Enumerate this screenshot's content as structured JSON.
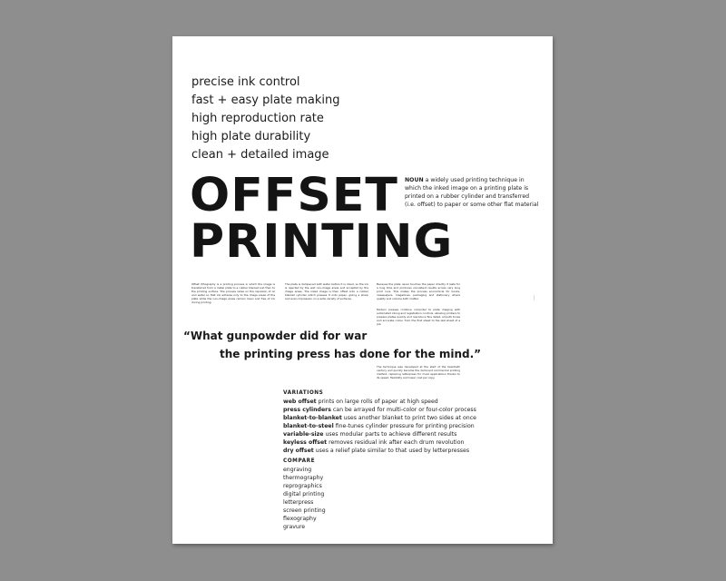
{
  "benefits": [
    "precise ink control",
    "fast + easy plate making",
    "high reproduction rate",
    "high plate durability",
    "clean + detailed image"
  ],
  "headline": {
    "line1": "OFFSET",
    "line2": "PRINTING"
  },
  "definition": {
    "part_of_speech": "NOUN",
    "text": "a widely used printing technique in which the inked image on a printing plate is printed on a rubber cylinder and transferred (i.e. offset) to paper or some other flat material"
  },
  "quote": {
    "line1": "“What gunpowder did for war",
    "line2": "the printing press has done for the mind.”"
  },
  "variations": {
    "title": "VARIATIONS",
    "items": [
      {
        "term": "web offset",
        "desc": " prints on large rolls of paper at high speed"
      },
      {
        "term": "press cylinders",
        "desc": " can be arrayed for multi-color or four-color process"
      },
      {
        "term": "blanket-to-blanket",
        "desc": " uses another blanket to print two sides at once"
      },
      {
        "term": "blanket-to-steel",
        "desc": " fine-tunes cylinder pressure for printing precision"
      },
      {
        "term": "variable-size",
        "desc": " uses modular parts to achieve different results"
      },
      {
        "term": "keyless offset",
        "desc": " removes residual ink after each drum revolution"
      },
      {
        "term": "dry offset",
        "desc": " uses a relief plate similar to that used by letterpresses"
      }
    ]
  },
  "compare": {
    "title": "COMPARE",
    "items": [
      "engraving",
      "thermography",
      "reprographics",
      "digital printing",
      "letterpress",
      "screen printing",
      "flexography",
      "gravure"
    ]
  }
}
